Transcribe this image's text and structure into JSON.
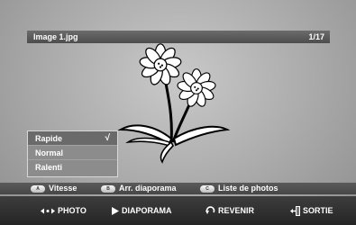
{
  "viewer": {
    "filename": "Image 1.jpg",
    "counter": "1/17"
  },
  "speed_menu": {
    "items": [
      {
        "label": "Rapide",
        "selected": true,
        "check": "√"
      },
      {
        "label": "Normal",
        "selected": false
      },
      {
        "label": "Ralenti",
        "selected": false
      }
    ]
  },
  "color_buttons": [
    {
      "key": "A",
      "label": "Vitesse"
    },
    {
      "key": "B",
      "label": "Arr. diaporama"
    },
    {
      "key": "C",
      "label": "Liste de photos"
    }
  ],
  "nav_bar": [
    {
      "icon": "left-right-arrows-icon",
      "label": "PHOTO"
    },
    {
      "icon": "play-icon",
      "label": "DIAPORAMA"
    },
    {
      "icon": "return-arrow-icon",
      "label": "REVENIR"
    },
    {
      "icon": "exit-door-icon",
      "label": "SORTIE"
    }
  ],
  "colors": {
    "background": "#a9a9a9",
    "title_bar": "#5a5a5a",
    "menu_bg": "#8c8c8c",
    "menu_selected": "#6a6a6a",
    "bottom_bar": "#2f2f2f"
  }
}
